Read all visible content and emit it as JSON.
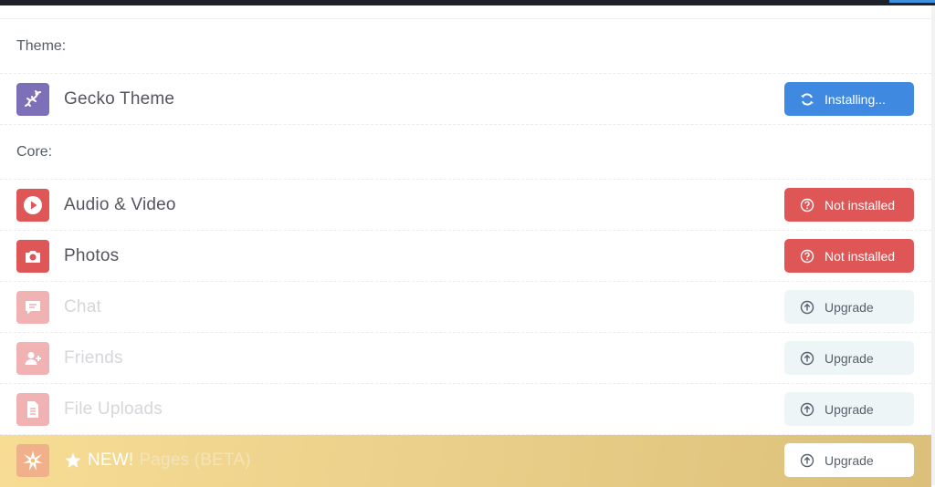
{
  "sections": {
    "theme_label": "Theme:",
    "core_label": "Core:"
  },
  "theme_item": {
    "name": "Gecko Theme",
    "icon": "gecko-icon",
    "icon_bg": "#7d6fb8",
    "button_label": "Installing...",
    "button_icon": "refresh-icon",
    "button_color": "#3f8ae0"
  },
  "core_items": [
    {
      "name": "Audio & Video",
      "icon": "play-icon",
      "icon_bg": "#df5656",
      "state": "enabled",
      "button_label": "Not installed",
      "button_icon": "question-circle-icon",
      "button_color": "#df5656"
    },
    {
      "name": "Photos",
      "icon": "camera-icon",
      "icon_bg": "#df5656",
      "state": "enabled",
      "button_label": "Not installed",
      "button_icon": "question-circle-icon",
      "button_color": "#df5656"
    },
    {
      "name": "Chat",
      "icon": "chat-bubble-icon",
      "icon_bg": "#df5656",
      "state": "disabled",
      "button_label": "Upgrade",
      "button_icon": "arrow-up-circle-icon",
      "button_color": "#eef5f7"
    },
    {
      "name": "Friends",
      "icon": "add-user-icon",
      "icon_bg": "#df5656",
      "state": "disabled",
      "button_label": "Upgrade",
      "button_icon": "arrow-up-circle-icon",
      "button_color": "#eef5f7"
    },
    {
      "name": "File Uploads",
      "icon": "document-icon",
      "icon_bg": "#df5656",
      "state": "disabled",
      "button_label": "Upgrade",
      "button_icon": "arrow-up-circle-icon",
      "button_color": "#eef5f7"
    }
  ],
  "promo_item": {
    "new_label": "NEW!",
    "name": "Pages (BETA)",
    "icon": "starburst-icon",
    "button_label": "Upgrade",
    "button_icon": "arrow-up-circle-icon",
    "button_color": "#ffffff"
  }
}
